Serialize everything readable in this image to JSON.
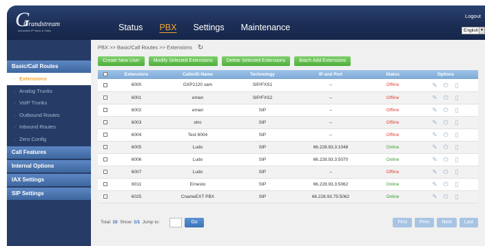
{
  "header": {
    "logo": {
      "brand": "Grandstream",
      "tagline": "Innovative IP Voice & Video"
    },
    "nav": [
      {
        "label": "Status",
        "active": false
      },
      {
        "label": "PBX",
        "active": true
      },
      {
        "label": "Settings",
        "active": false
      },
      {
        "label": "Maintenance",
        "active": false
      }
    ],
    "logout_label": "Logout",
    "language": "English"
  },
  "sidebar": {
    "sections": [
      {
        "label": "Basic/Call Routes",
        "items": [
          {
            "label": "Extensions",
            "active": true
          },
          {
            "label": "Analog Trunks",
            "active": false
          },
          {
            "label": "VoIP Trunks",
            "active": false
          },
          {
            "label": "Outbound Routes",
            "active": false
          },
          {
            "label": "Inbound Routes",
            "active": false
          },
          {
            "label": "Zero Config",
            "active": false
          }
        ]
      },
      {
        "label": "Call Features",
        "items": []
      },
      {
        "label": "Internal Options",
        "items": []
      },
      {
        "label": "IAX Settings",
        "items": []
      },
      {
        "label": "SIP Settings",
        "items": []
      }
    ]
  },
  "main": {
    "breadcrumb": "PBX >> Basic/Call Routes >> Extensions",
    "actions": {
      "create": "Create New User",
      "modify": "Modify Selected Extensions",
      "delete": "Delete Selected Extensions",
      "batch_add": "Batch Add Extensions"
    },
    "table": {
      "columns": [
        "Extensions",
        "CallerID Name",
        "Technology",
        "IP and Port",
        "Status",
        "Options"
      ],
      "rows": [
        {
          "ext": "6000",
          "name": "GXP2120 sam",
          "tech": "SIP/FXS1",
          "ip": "--",
          "status": "Offline"
        },
        {
          "ext": "6001",
          "name": "eman",
          "tech": "SIP/FXS2",
          "ip": "--",
          "status": "Offline"
        },
        {
          "ext": "6002",
          "name": "eman",
          "tech": "SIP",
          "ip": "--",
          "status": "Offline"
        },
        {
          "ext": "6003",
          "name": "otro",
          "tech": "SIP",
          "ip": "--",
          "status": "Offline"
        },
        {
          "ext": "6004",
          "name": "Test 6004",
          "tech": "SIP",
          "ip": "--",
          "status": "Offline"
        },
        {
          "ext": "6005",
          "name": "Ludo",
          "tech": "SIP",
          "ip": "66.228.93.3:1048",
          "status": "Online"
        },
        {
          "ext": "6006",
          "name": "Ludo",
          "tech": "SIP",
          "ip": "66.228.93.3:5070",
          "status": "Online"
        },
        {
          "ext": "6007",
          "name": "Ludo",
          "tech": "SIP",
          "ip": "--",
          "status": "Offline"
        },
        {
          "ext": "6011",
          "name": "Ernesto",
          "tech": "SIP",
          "ip": "66.228.93.3:5062",
          "status": "Online"
        },
        {
          "ext": "6025",
          "name": "CnameEXT PBX",
          "tech": "SIP",
          "ip": "66.228.93.75:5062",
          "status": "Online"
        }
      ]
    },
    "footer": {
      "total_label": "Total:",
      "total": "10",
      "show_label": "Show:",
      "show": "1/1",
      "jump_label": "Jump to:",
      "jump_value": "",
      "go": "Go",
      "pager": {
        "first": "First",
        "prev": "Prev",
        "next": "Next",
        "last": "Last"
      }
    }
  },
  "colors": {
    "accent_orange": "#f6a533",
    "offline": "#e0403b",
    "online": "#3a9c2e",
    "action_green": "#4fae3c",
    "header_navy": "#1d2f55"
  }
}
